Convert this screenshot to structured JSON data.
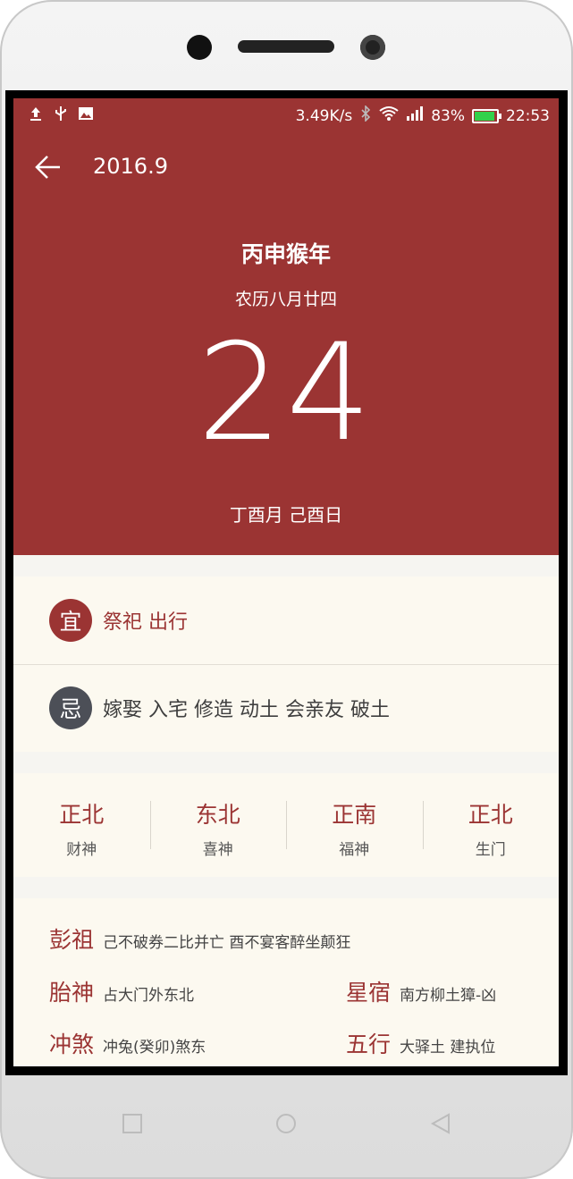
{
  "status_bar": {
    "network_speed": "3.49K/s",
    "battery_percent": "83%",
    "battery_level": 0.83,
    "time": "22:53",
    "left_icons": [
      "upload-icon",
      "usb-icon",
      "image-icon"
    ],
    "right_icons": [
      "bluetooth-icon",
      "wifi-icon",
      "signal-icon",
      "battery-icon"
    ]
  },
  "header": {
    "date": "2016.9"
  },
  "hero": {
    "year_title": "丙申猴年",
    "lunar_date": "农历八月廿四",
    "day": "24",
    "ganzhi": "丁酉月 己酉日",
    "background_color": "#9b3433"
  },
  "yi": {
    "badge": "宜",
    "text": "祭祀 出行"
  },
  "ji": {
    "badge": "忌",
    "text": "嫁娶 入宅 修造 动土 会亲友 破土"
  },
  "directions": [
    {
      "value": "正北",
      "label": "财神"
    },
    {
      "value": "东北",
      "label": "喜神"
    },
    {
      "value": "正南",
      "label": "福神"
    },
    {
      "value": "正北",
      "label": "生门"
    }
  ],
  "misc": {
    "pengzu": {
      "key": "彭祖",
      "value": "己不破券二比并亡 酉不宴客醉坐颠狂"
    },
    "taishen": {
      "key": "胎神",
      "value": "占大门外东北"
    },
    "xingxiu": {
      "key": "星宿",
      "value": "南方柳土獐-凶"
    },
    "chongsha": {
      "key": "冲煞",
      "value": "冲兔(癸卯)煞东"
    },
    "wuxing": {
      "key": "五行",
      "value": "大驿土 建执位"
    }
  },
  "colors": {
    "accent": "#9b3433",
    "card_bg": "#fcf9f0",
    "ji_badge": "#4c4f57"
  }
}
